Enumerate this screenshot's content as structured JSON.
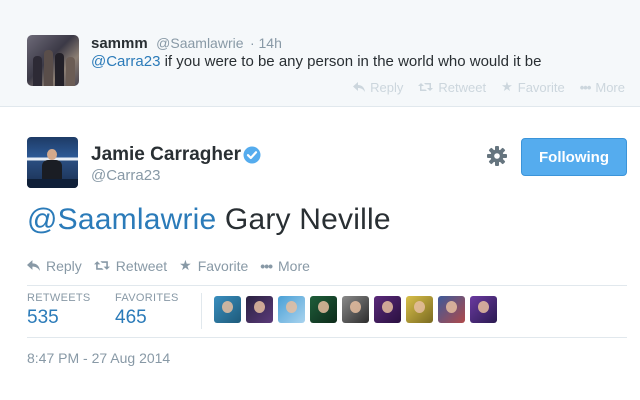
{
  "parent_tweet": {
    "name": "sammm",
    "handle": "@Saamlawrie",
    "time": "· 14h",
    "mention": "@Carra23",
    "text": " if you were to be any person in the world who would it be",
    "actions": [
      {
        "icon": "reply-icon",
        "label": "Reply"
      },
      {
        "icon": "retweet-icon",
        "label": "Retweet"
      },
      {
        "icon": "star-icon",
        "label": "Favorite"
      },
      {
        "icon": "more-icon",
        "label": "More"
      }
    ]
  },
  "main_tweet": {
    "name": "Jamie Carragher",
    "handle": "@Carra23",
    "follow_label": "Following",
    "mention": "@Saamlawrie",
    "text": " Gary Neville",
    "actions": [
      {
        "icon": "reply-icon",
        "label": "Reply"
      },
      {
        "icon": "retweet-icon",
        "label": "Retweet"
      },
      {
        "icon": "star-icon",
        "label": "Favorite"
      },
      {
        "icon": "more-icon",
        "label": "More"
      }
    ],
    "stats": {
      "retweets_label": "RETWEETS",
      "retweets_value": "535",
      "favorites_label": "FAVORITES",
      "favorites_value": "465"
    },
    "favoriter_avatar_count": 9,
    "timestamp": "8:47 PM - 27 Aug 2014"
  },
  "colors": {
    "link": "#2b7bb9",
    "follow_button": "#55acee",
    "muted_text": "#8899a6",
    "verified": "#55acee"
  }
}
